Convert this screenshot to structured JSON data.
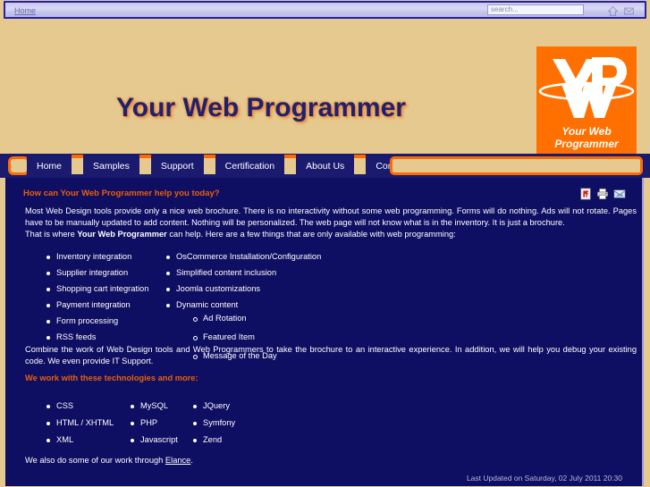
{
  "topbar": {
    "breadcrumb": "Home",
    "search_placeholder": "search...",
    "search_value": "",
    "icons": [
      "home-icon",
      "mail-icon"
    ]
  },
  "header": {
    "site_title": "Your Web Programmer",
    "logo": {
      "mark": "YWP",
      "line1": "Your Web",
      "line2": "Programmer",
      "background_color": "#ff7000"
    }
  },
  "nav": {
    "items": [
      {
        "label": "Home"
      },
      {
        "label": "Samples"
      },
      {
        "label": "Support"
      },
      {
        "label": "Certification"
      },
      {
        "label": "About Us"
      },
      {
        "label": "Contact Us"
      }
    ]
  },
  "article": {
    "heading": "How can Your Web Programmer help you today?",
    "icons": [
      "pdf-icon",
      "print-icon",
      "email-icon"
    ],
    "paragraph1": "Most Web Design tools provide only a nice web brochure. There is no interactivity without some web programming. Forms will do nothing. Ads will not rotate. Pages have to be manually updated to add content. Nothing will be personalized. The web page will not know what is in the inventory. It is just a brochure.",
    "paragraph2_before": "That is where ",
    "paragraph2_bold": "Your Web Programmer",
    "paragraph2_after": " can help. Here are a few things that are only available with web programming:",
    "bullets_col1": [
      "Inventory integration",
      "Supplier integration",
      "Shopping cart integration",
      "Payment integration",
      "Form processing",
      "RSS feeds"
    ],
    "bullets_col2": [
      "OsCommerce Installation/Configuration",
      "Simplified content inclusion",
      "Joomla customizations",
      "Dynamic content"
    ],
    "bullets_sub": [
      "Ad Rotation",
      "Featured Item",
      "Message of the Day"
    ],
    "paragraph3": "Combine the work of Web Design tools and Web Programmers to take the brochure to an interactive experience. In addition, we will help you debug your existing code. We even provide IT Support.",
    "tech_heading": "We work with these technologies and more:",
    "tech_col1": [
      "CSS",
      "HTML / XHTML",
      "XML"
    ],
    "tech_col2": [
      "MySQL",
      "PHP",
      "Javascript"
    ],
    "tech_col3": [
      "JQuery",
      "Symfony",
      "Zend"
    ],
    "elance_before": "We also do some of our work through ",
    "elance_link": "Elance",
    "elance_after": ".",
    "last_updated": "Last Updated on Saturday, 02 July 2011 20:30"
  },
  "colors": {
    "page_background": "#e6c98e",
    "content_background": "#0e0e62",
    "accent_orange": "#ff6a00",
    "heading_orange": "#e8600c",
    "nav_navy": "#1a1a6e",
    "title_navy": "#20216e"
  }
}
